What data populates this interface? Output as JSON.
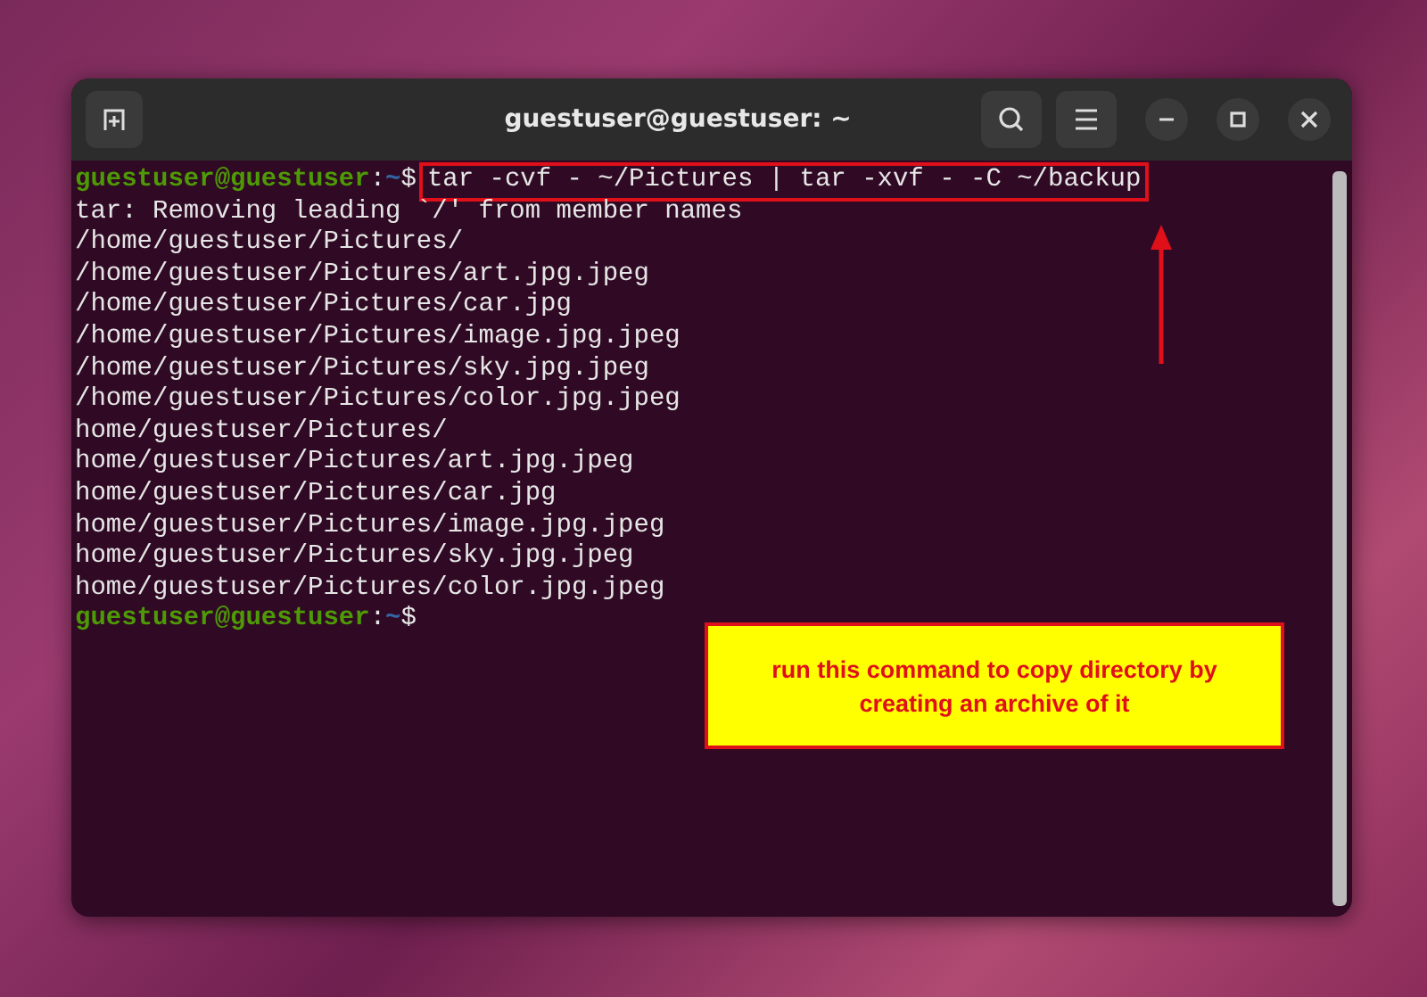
{
  "window": {
    "title": "guestuser@guestuser: ~"
  },
  "terminal": {
    "lines": [
      {
        "kind": "prompt",
        "user": "guestuser@guestuser",
        "separator": ":",
        "path": "~",
        "symbol": "$",
        "command": "tar -cvf - ~/Pictures | tar -xvf - -C ~/backup",
        "highlighted": true
      },
      {
        "kind": "output",
        "text": "tar: Removing leading `/' from member names"
      },
      {
        "kind": "output",
        "text": "/home/guestuser/Pictures/"
      },
      {
        "kind": "output",
        "text": "/home/guestuser/Pictures/art.jpg.jpeg"
      },
      {
        "kind": "output",
        "text": "/home/guestuser/Pictures/car.jpg"
      },
      {
        "kind": "output",
        "text": "/home/guestuser/Pictures/image.jpg.jpeg"
      },
      {
        "kind": "output",
        "text": "/home/guestuser/Pictures/sky.jpg.jpeg"
      },
      {
        "kind": "output",
        "text": "/home/guestuser/Pictures/color.jpg.jpeg"
      },
      {
        "kind": "output",
        "text": "home/guestuser/Pictures/"
      },
      {
        "kind": "output",
        "text": "home/guestuser/Pictures/art.jpg.jpeg"
      },
      {
        "kind": "output",
        "text": "home/guestuser/Pictures/car.jpg"
      },
      {
        "kind": "output",
        "text": "home/guestuser/Pictures/image.jpg.jpeg"
      },
      {
        "kind": "output",
        "text": "home/guestuser/Pictures/sky.jpg.jpeg"
      },
      {
        "kind": "output",
        "text": "home/guestuser/Pictures/color.jpg.jpeg"
      },
      {
        "kind": "prompt",
        "user": "guestuser@guestuser",
        "separator": ":",
        "path": "~",
        "symbol": "$"
      }
    ]
  },
  "annotation": {
    "text": "run this command to copy directory by creating an archive of it"
  }
}
